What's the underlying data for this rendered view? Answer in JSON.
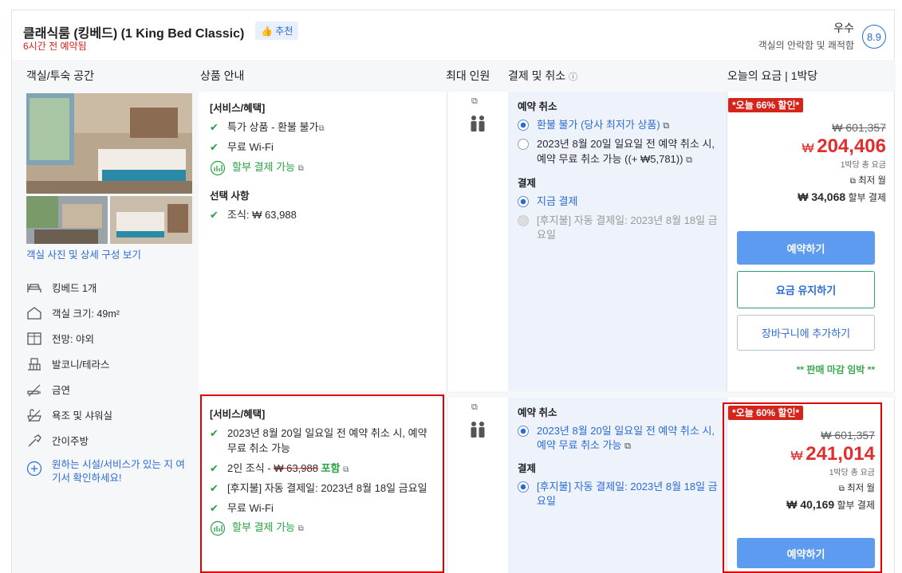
{
  "room": {
    "title": "클래식룸 (킹베드) (1 King Bed Classic)",
    "recent": "6시간 전 예약됨",
    "recommend": "추천",
    "rating_word": "우수",
    "rating_desc": "객실의 안락함 및 쾌적함",
    "rating_score": "8.9"
  },
  "headers": {
    "room_space": "객실/투숙 공간",
    "product": "상품 안내",
    "max_guests": "최대 인원",
    "payment_cancel": "결제 및 취소",
    "price_today": "오늘의 요금 | 1박당"
  },
  "left": {
    "photo_link": "객실 사진 및 상세 구성 보기",
    "features": [
      {
        "icon": "bed-icon",
        "label": "킹베드 1개"
      },
      {
        "icon": "room-size-icon",
        "label": "객실 크기: 49m²"
      },
      {
        "icon": "window-view-icon",
        "label": "전망: 야외"
      },
      {
        "icon": "balcony-icon",
        "label": "발코니/테라스"
      },
      {
        "icon": "no-smoking-icon",
        "label": "금연"
      },
      {
        "icon": "bath-shower-icon",
        "label": "욕조 및 샤워실"
      },
      {
        "icon": "kitchenette-icon",
        "label": "간이주방"
      }
    ],
    "more_link": "원하는 시설/서비스가 있는 지 여기서 확인하세요!"
  },
  "offers": [
    {
      "services_title": "[서비스/혜택]",
      "services": [
        "특가 상품 - 환불 불가",
        "무료 Wi-Fi"
      ],
      "installment": "할부 결제 가능",
      "options_title": "선택 사항",
      "option_prefix": "조식: ",
      "option_price": "₩ 63,988",
      "cancel_title": "예약 취소",
      "cancel_opt1": "환불 불가 (당사 최저가 상품)",
      "cancel_opt2": "2023년 8월 20일 일요일 전 예약 취소 시, 예약 무료 취소 가능 ((+ ₩5,781))",
      "pay_title": "결제",
      "pay_opt1": "지금 결제",
      "pay_opt2": "[후지불] 자동 결제일: 2023년 8월 18일 금요일",
      "deal": "*오늘 66% 할인*",
      "original": "₩ 601,357",
      "currency": "₩",
      "price": "204,406",
      "per_night_total": "1박당 총 요금",
      "monthly_prefix": "최저 월",
      "installment_price": "₩ 34,068",
      "installment_suffix": " 할부 결제",
      "book": "예약하기",
      "keep_price": "요금 유지하기",
      "add_cart": "장바구니에 추가하기",
      "closing": "** 판매 마감 임박 **"
    },
    {
      "services_title": "[서비스/혜택]",
      "svc1": "2023년 8월 20일 일요일 전 예약 취소 시, 예약 무료 취소 가능",
      "svc2_prefix": "2인 조식 - ",
      "svc2_strike": "₩ 63,988",
      "svc2_included": "포함",
      "svc3": "[후지불] 자동 결제일: 2023년 8월 18일 금요일",
      "svc4": "무료 Wi-Fi",
      "installment": "할부 결제 가능",
      "cancel_title": "예약 취소",
      "cancel_opt1": "2023년 8월 20일 일요일 전 예약 취소 시, 예약 무료 취소 가능",
      "pay_title": "결제",
      "pay_opt1": "[후지불] 자동 결제일: 2023년 8월 18일 금요일",
      "deal": "*오늘 60% 할인*",
      "original": "₩ 601,357",
      "currency": "₩",
      "price": "241,014",
      "per_night_total": "1박당 총 요금",
      "monthly_prefix": "최저 월",
      "installment_price": "₩ 40,169",
      "installment_suffix": " 할부 결제",
      "book": "예약하기"
    }
  ]
}
